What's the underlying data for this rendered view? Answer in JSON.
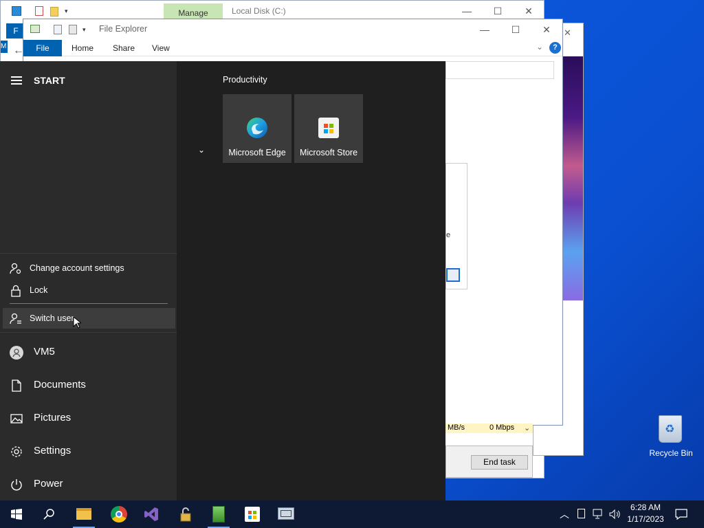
{
  "task_manager": {
    "tab_manage": "Manage",
    "title": "Local Disk (C:)",
    "net_speed": "MB/s",
    "net_mbps": "0 Mbps",
    "end_task": "End task",
    "partial_text": "e"
  },
  "file_explorer": {
    "title": "File Explorer",
    "tabs": [
      "File",
      "Home",
      "Share",
      "View"
    ],
    "help": "?",
    "back_f": "F",
    "m_label": "M"
  },
  "start_menu": {
    "header": "START",
    "group": "Productivity",
    "tiles": [
      {
        "label": "Microsoft Edge",
        "icon": "edge-icon"
      },
      {
        "label": "Microsoft Store",
        "icon": "store-icon"
      }
    ],
    "account_flyout": [
      {
        "label": "Change account settings",
        "icon": "account-settings-icon"
      },
      {
        "label": "Lock",
        "icon": "lock-icon"
      },
      {
        "label": "Switch user",
        "icon": "switch-user-icon"
      }
    ],
    "nav": [
      {
        "label": "VM5",
        "icon": "user-avatar-icon"
      },
      {
        "label": "Documents",
        "icon": "document-icon"
      },
      {
        "label": "Pictures",
        "icon": "pictures-icon"
      },
      {
        "label": "Settings",
        "icon": "gear-icon"
      },
      {
        "label": "Power",
        "icon": "power-icon"
      }
    ]
  },
  "desktop": {
    "recycle_bin": "Recycle Bin"
  },
  "taskbar": {
    "time": "6:28 AM",
    "date": "1/17/2023",
    "apps": [
      "start-icon",
      "search-icon",
      "file-explorer-icon",
      "chrome-icon",
      "visual-studio-icon",
      "unlock-tool-icon",
      "server-manager-icon",
      "store-icon",
      "network-tool-icon"
    ]
  },
  "colors": {
    "accent": "#0063b1",
    "start_bg": "#1f1f1f",
    "start_left": "#2b2b2b",
    "tile": "#3b3b3b",
    "taskbar": "#0e1a33",
    "manage_tab": "#c8e6b4"
  }
}
